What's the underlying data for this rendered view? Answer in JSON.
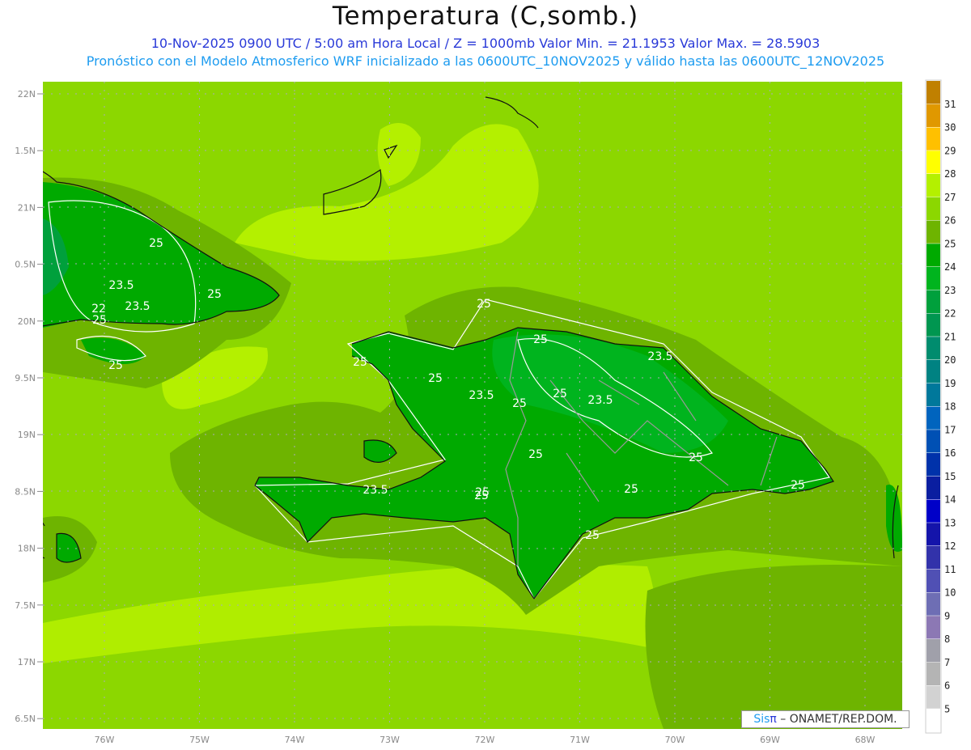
{
  "header": {
    "title": "Temperatura (C,somb.)",
    "subtitle1": "10-Nov-2025  0900 UTC / 5:00 am Hora Local / Z = 1000mb    Valor Min. = 21.1953   Valor Max. = 28.5903",
    "subtitle2": "Pronóstico con el Modelo Atmosferico WRF inicializado a las 0600UTC_10NOV2025 y válido hasta las  0600UTC_12NOV2025"
  },
  "axes": {
    "lon_labels": [
      "76W",
      "75W",
      "74W",
      "73W",
      "72W",
      "71W",
      "70W",
      "69W",
      "68W"
    ],
    "lat_labels": [
      "22N",
      "1.5N",
      "21N",
      "0.5N",
      "20N",
      "9.5N",
      "19N",
      "8.5N",
      "18N",
      "7.5N",
      "17N",
      "6.5N"
    ]
  },
  "contour_labels": [
    "25",
    "23.5",
    "25",
    "22",
    "23.5",
    "25",
    "25",
    "25",
    "25",
    "23.5",
    "25",
    "25",
    "23.5",
    "25",
    "25",
    "23.5",
    "25",
    "25",
    "23.5",
    "25",
    "25",
    "25",
    "25",
    "25"
  ],
  "colorbar": {
    "labels": [
      "31",
      "30",
      "29",
      "28",
      "27",
      "26",
      "25",
      "24",
      "23",
      "22",
      "21",
      "20",
      "19",
      "18",
      "17",
      "16",
      "15",
      "14",
      "13",
      "12",
      "11",
      "10",
      "9",
      "8",
      "7",
      "6",
      "5"
    ],
    "colors": [
      "#c08000",
      "#e09800",
      "#ffc000",
      "#ffff00",
      "#b4f000",
      "#8cd700",
      "#6eb400",
      "#00aa00",
      "#00b41e",
      "#00a03c",
      "#009650",
      "#008c6e",
      "#008282",
      "#00789b",
      "#0064be",
      "#0050b4",
      "#0032aa",
      "#0a1ea0",
      "#0000c8",
      "#1414aa",
      "#3232aa",
      "#5050b4",
      "#6e6eb4",
      "#8c78b4",
      "#a0a0aa",
      "#b4b4b4",
      "#d2d2d2",
      "#ffffff"
    ]
  },
  "logo": {
    "sis": "Sis",
    "pi": "π",
    "rest": " – ONAMET/REP.DOM."
  }
}
